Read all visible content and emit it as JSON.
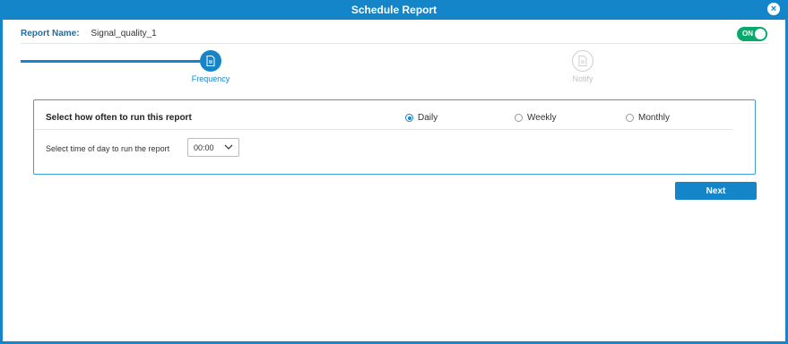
{
  "dialog": {
    "title": "Schedule Report",
    "close_symbol": "×"
  },
  "report": {
    "label": "Report Name:",
    "name": "Signal_quality_1"
  },
  "toggle": {
    "label": "ON",
    "state": "on"
  },
  "steps": [
    {
      "label": "Frequency",
      "state": "active",
      "icon": "document-icon"
    },
    {
      "label": "Notify",
      "state": "inactive",
      "icon": "document-icon"
    }
  ],
  "frequency": {
    "question": "Select how often to run this report",
    "options": [
      {
        "label": "Daily",
        "selected": true
      },
      {
        "label": "Weekly",
        "selected": false
      },
      {
        "label": "Monthly",
        "selected": false
      }
    ],
    "time_label": "Select time of day to run the report",
    "time_value": "00:00"
  },
  "actions": {
    "next_label": "Next"
  },
  "colors": {
    "accent": "#1585c9",
    "toggle_on": "#0aa86b"
  }
}
